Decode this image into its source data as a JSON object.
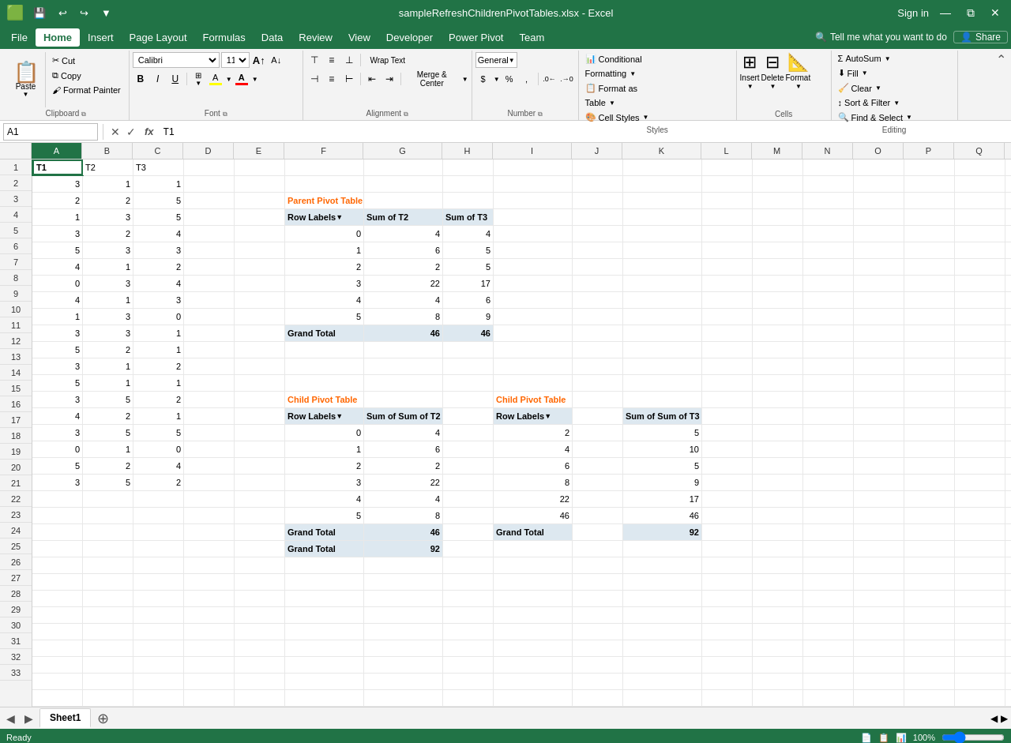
{
  "titleBar": {
    "quickAccess": [
      "💾",
      "↩",
      "↪",
      "▼"
    ],
    "title": "sampleRefreshChildrenPivotTables.xlsx - Excel",
    "signIn": "Sign in",
    "windowBtns": [
      "—",
      "⧉",
      "✕"
    ]
  },
  "menuBar": {
    "items": [
      "File",
      "Home",
      "Insert",
      "Page Layout",
      "Formulas",
      "Data",
      "Review",
      "View",
      "Developer",
      "Power Pivot",
      "Team"
    ],
    "activeItem": "Home",
    "searchPlaceholder": "Tell me what you want to do",
    "shareLabel": "Share"
  },
  "ribbon": {
    "clipboard": {
      "label": "Clipboard",
      "pasteLabel": "Paste",
      "buttons": [
        "Cut",
        "Copy",
        "Format Painter"
      ]
    },
    "font": {
      "label": "Font",
      "fontName": "Calibri",
      "fontSize": "11",
      "bold": "B",
      "italic": "I",
      "underline": "U",
      "increaseFont": "A",
      "decreaseFont": "A",
      "borders": "⊞",
      "fillColor": "A",
      "fontColor": "A",
      "fillColorBar": "#FFFF00",
      "fontColorBar": "#FF0000"
    },
    "alignment": {
      "label": "Alignment",
      "wrapText": "Wrap Text",
      "mergeCenter": "Merge & Center",
      "alignButtons": [
        "≡",
        "≡",
        "≡",
        "⊣",
        "≡",
        "⊢"
      ],
      "indentButtons": [
        "⇤",
        "⇥"
      ]
    },
    "number": {
      "label": "Number",
      "format": "General",
      "currency": "$",
      "percent": "%",
      "comma": ",",
      "decInc": ".0",
      "decDec": ".00"
    },
    "styles": {
      "label": "Styles",
      "conditionalFormatting": "Conditional Formatting",
      "formatAsTable": "Format as Table",
      "cellStyles": "Cell Styles"
    },
    "cells": {
      "label": "Cells",
      "insert": "Insert",
      "delete": "Delete",
      "format": "Format"
    },
    "editing": {
      "label": "Editing",
      "autoSum": "AutoSum",
      "fill": "Fill",
      "clear": "Clear",
      "sortFilter": "Sort & Filter",
      "findSelect": "Find & Select"
    }
  },
  "formulaBar": {
    "nameBox": "A1",
    "formula": "T1"
  },
  "columns": [
    "A",
    "B",
    "C",
    "D",
    "E",
    "F",
    "G",
    "H",
    "I",
    "J",
    "K",
    "L",
    "M",
    "N",
    "O",
    "P",
    "Q"
  ],
  "rows": [
    1,
    2,
    3,
    4,
    5,
    6,
    7,
    8,
    9,
    10,
    11,
    12,
    13,
    14,
    15,
    16,
    17,
    18,
    19,
    20,
    21,
    22,
    23,
    24,
    25,
    26,
    27,
    28,
    29,
    30,
    31,
    32,
    33
  ],
  "cellData": {
    "A1": {
      "v": "T1",
      "bold": true
    },
    "B1": {
      "v": "T2"
    },
    "C1": {
      "v": "T3"
    },
    "A2": {
      "v": "3",
      "align": "right"
    },
    "B2": {
      "v": "1",
      "align": "right"
    },
    "C2": {
      "v": "1",
      "align": "right"
    },
    "A3": {
      "v": "2",
      "align": "right"
    },
    "B3": {
      "v": "2",
      "align": "right"
    },
    "C3": {
      "v": "5",
      "align": "right"
    },
    "A4": {
      "v": "1",
      "align": "right"
    },
    "B4": {
      "v": "3",
      "align": "right"
    },
    "C4": {
      "v": "5",
      "align": "right"
    },
    "A5": {
      "v": "3",
      "align": "right"
    },
    "B5": {
      "v": "2",
      "align": "right"
    },
    "C5": {
      "v": "4",
      "align": "right"
    },
    "A6": {
      "v": "5",
      "align": "right"
    },
    "B6": {
      "v": "3",
      "align": "right"
    },
    "C6": {
      "v": "3",
      "align": "right"
    },
    "A7": {
      "v": "4",
      "align": "right"
    },
    "B7": {
      "v": "1",
      "align": "right"
    },
    "C7": {
      "v": "2",
      "align": "right"
    },
    "A8": {
      "v": "0",
      "align": "right"
    },
    "B8": {
      "v": "3",
      "align": "right"
    },
    "C8": {
      "v": "4",
      "align": "right"
    },
    "A9": {
      "v": "4",
      "align": "right"
    },
    "B9": {
      "v": "1",
      "align": "right"
    },
    "C9": {
      "v": "3",
      "align": "right"
    },
    "A10": {
      "v": "1",
      "align": "right"
    },
    "B10": {
      "v": "3",
      "align": "right"
    },
    "C10": {
      "v": "0",
      "align": "right"
    },
    "A11": {
      "v": "3",
      "align": "right"
    },
    "B11": {
      "v": "3",
      "align": "right"
    },
    "C11": {
      "v": "1",
      "align": "right"
    },
    "A12": {
      "v": "5",
      "align": "right"
    },
    "B12": {
      "v": "2",
      "align": "right"
    },
    "C12": {
      "v": "1",
      "align": "right"
    },
    "A13": {
      "v": "3",
      "align": "right"
    },
    "B13": {
      "v": "1",
      "align": "right"
    },
    "C13": {
      "v": "2",
      "align": "right"
    },
    "A14": {
      "v": "5",
      "align": "right"
    },
    "B14": {
      "v": "1",
      "align": "right"
    },
    "C14": {
      "v": "1",
      "align": "right"
    },
    "A15": {
      "v": "3",
      "align": "right"
    },
    "B15": {
      "v": "5",
      "align": "right"
    },
    "C15": {
      "v": "2",
      "align": "right"
    },
    "A16": {
      "v": "4",
      "align": "right"
    },
    "B16": {
      "v": "2",
      "align": "right"
    },
    "C16": {
      "v": "1",
      "align": "right"
    },
    "A17": {
      "v": "3",
      "align": "right"
    },
    "B17": {
      "v": "5",
      "align": "right"
    },
    "C17": {
      "v": "5",
      "align": "right"
    },
    "A18": {
      "v": "0",
      "align": "right"
    },
    "B18": {
      "v": "1",
      "align": "right"
    },
    "C18": {
      "v": "0",
      "align": "right"
    },
    "A19": {
      "v": "5",
      "align": "right"
    },
    "B19": {
      "v": "2",
      "align": "right"
    },
    "C19": {
      "v": "4",
      "align": "right"
    },
    "A20": {
      "v": "3",
      "align": "right"
    },
    "B20": {
      "v": "5",
      "align": "right"
    },
    "C20": {
      "v": "2",
      "align": "right"
    },
    "F3": {
      "v": "Parent Pivot Table",
      "color": "#FF6600",
      "bold": true
    },
    "F4": {
      "v": "Row Labels",
      "bgColor": "#dde8f0",
      "bold": true,
      "hasFilter": true
    },
    "G4": {
      "v": "Sum of T2",
      "bgColor": "#dde8f0",
      "bold": true
    },
    "H4": {
      "v": "Sum of T3",
      "bgColor": "#dde8f0",
      "bold": true
    },
    "F5": {
      "v": "0",
      "align": "right"
    },
    "G5": {
      "v": "4",
      "align": "right"
    },
    "H5": {
      "v": "4",
      "align": "right"
    },
    "F6": {
      "v": "1",
      "align": "right"
    },
    "G6": {
      "v": "6",
      "align": "right"
    },
    "H6": {
      "v": "5",
      "align": "right"
    },
    "F7": {
      "v": "2",
      "align": "right"
    },
    "G7": {
      "v": "2",
      "align": "right"
    },
    "H7": {
      "v": "5",
      "align": "right"
    },
    "F8": {
      "v": "3",
      "align": "right"
    },
    "G8": {
      "v": "22",
      "align": "right"
    },
    "H8": {
      "v": "17",
      "align": "right"
    },
    "F9": {
      "v": "4",
      "align": "right"
    },
    "G9": {
      "v": "4",
      "align": "right"
    },
    "H9": {
      "v": "6",
      "align": "right"
    },
    "F10": {
      "v": "5",
      "align": "right"
    },
    "G10": {
      "v": "8",
      "align": "right"
    },
    "H10": {
      "v": "9",
      "align": "right"
    },
    "F11": {
      "v": "Grand Total",
      "bgColor": "#dde8f0",
      "bold": true
    },
    "G11": {
      "v": "46",
      "align": "right",
      "bgColor": "#dde8f0",
      "bold": true
    },
    "H11": {
      "v": "46",
      "align": "right",
      "bgColor": "#dde8f0",
      "bold": true
    },
    "F15": {
      "v": "Child Pivot Table",
      "color": "#FF6600",
      "bold": true
    },
    "I15": {
      "v": "Child Pivot Table",
      "color": "#FF6600",
      "bold": true
    },
    "F16": {
      "v": "Row Labels",
      "bgColor": "#dde8f0",
      "bold": true,
      "hasFilter": true
    },
    "G16": {
      "v": "Sum of Sum of T2",
      "bgColor": "#dde8f0",
      "bold": true
    },
    "I16": {
      "v": "Row Labels",
      "bgColor": "#dde8f0",
      "bold": true,
      "hasFilter": true
    },
    "K16": {
      "v": "Sum of Sum of T3",
      "bgColor": "#dde8f0",
      "bold": true
    },
    "F17": {
      "v": "0",
      "align": "right"
    },
    "G17": {
      "v": "4",
      "align": "right"
    },
    "I17": {
      "v": "2",
      "align": "right"
    },
    "K17": {
      "v": "5",
      "align": "right"
    },
    "F18": {
      "v": "1",
      "align": "right"
    },
    "G18": {
      "v": "6",
      "align": "right"
    },
    "I18": {
      "v": "4",
      "align": "right"
    },
    "K18": {
      "v": "10",
      "align": "right"
    },
    "F19": {
      "v": "2",
      "align": "right"
    },
    "G19": {
      "v": "2",
      "align": "right"
    },
    "I19": {
      "v": "6",
      "align": "right"
    },
    "K19": {
      "v": "5",
      "align": "right"
    },
    "F20": {
      "v": "3",
      "align": "right"
    },
    "G20": {
      "v": "22",
      "align": "right"
    },
    "I20": {
      "v": "8",
      "align": "right"
    },
    "K20": {
      "v": "9",
      "align": "right"
    },
    "F21": {
      "v": "4",
      "align": "right"
    },
    "G21": {
      "v": "4",
      "align": "right"
    },
    "I21": {
      "v": "22",
      "align": "right"
    },
    "K21": {
      "v": "17",
      "align": "right"
    },
    "F22": {
      "v": "5",
      "align": "right"
    },
    "G22": {
      "v": "8",
      "align": "right"
    },
    "I22": {
      "v": "46",
      "align": "right"
    },
    "K22": {
      "v": "46",
      "align": "right"
    },
    "F23": {
      "v": "Grand Total",
      "bgColor": "#dde8f0",
      "bold": true
    },
    "G23": {
      "v": "46",
      "align": "right",
      "bgColor": "#dde8f0",
      "bold": true
    },
    "I23": {
      "v": "Grand Total",
      "bgColor": "#dde8f0",
      "bold": true
    },
    "K23": {
      "v": "92",
      "align": "right",
      "bgColor": "#dde8f0",
      "bold": true
    },
    "F24": {
      "v": "Grand Total",
      "bgColor": "#dde8f0",
      "bold": true
    },
    "G24": {
      "v": "92",
      "align": "right",
      "bgColor": "#dde8f0",
      "bold": true
    }
  },
  "sheetTabs": [
    "Sheet1"
  ],
  "activeSheet": "Sheet1",
  "statusBar": {
    "left": "Ready",
    "viewButtons": [
      "📊",
      "📋",
      "📄"
    ],
    "zoom": "100%"
  }
}
